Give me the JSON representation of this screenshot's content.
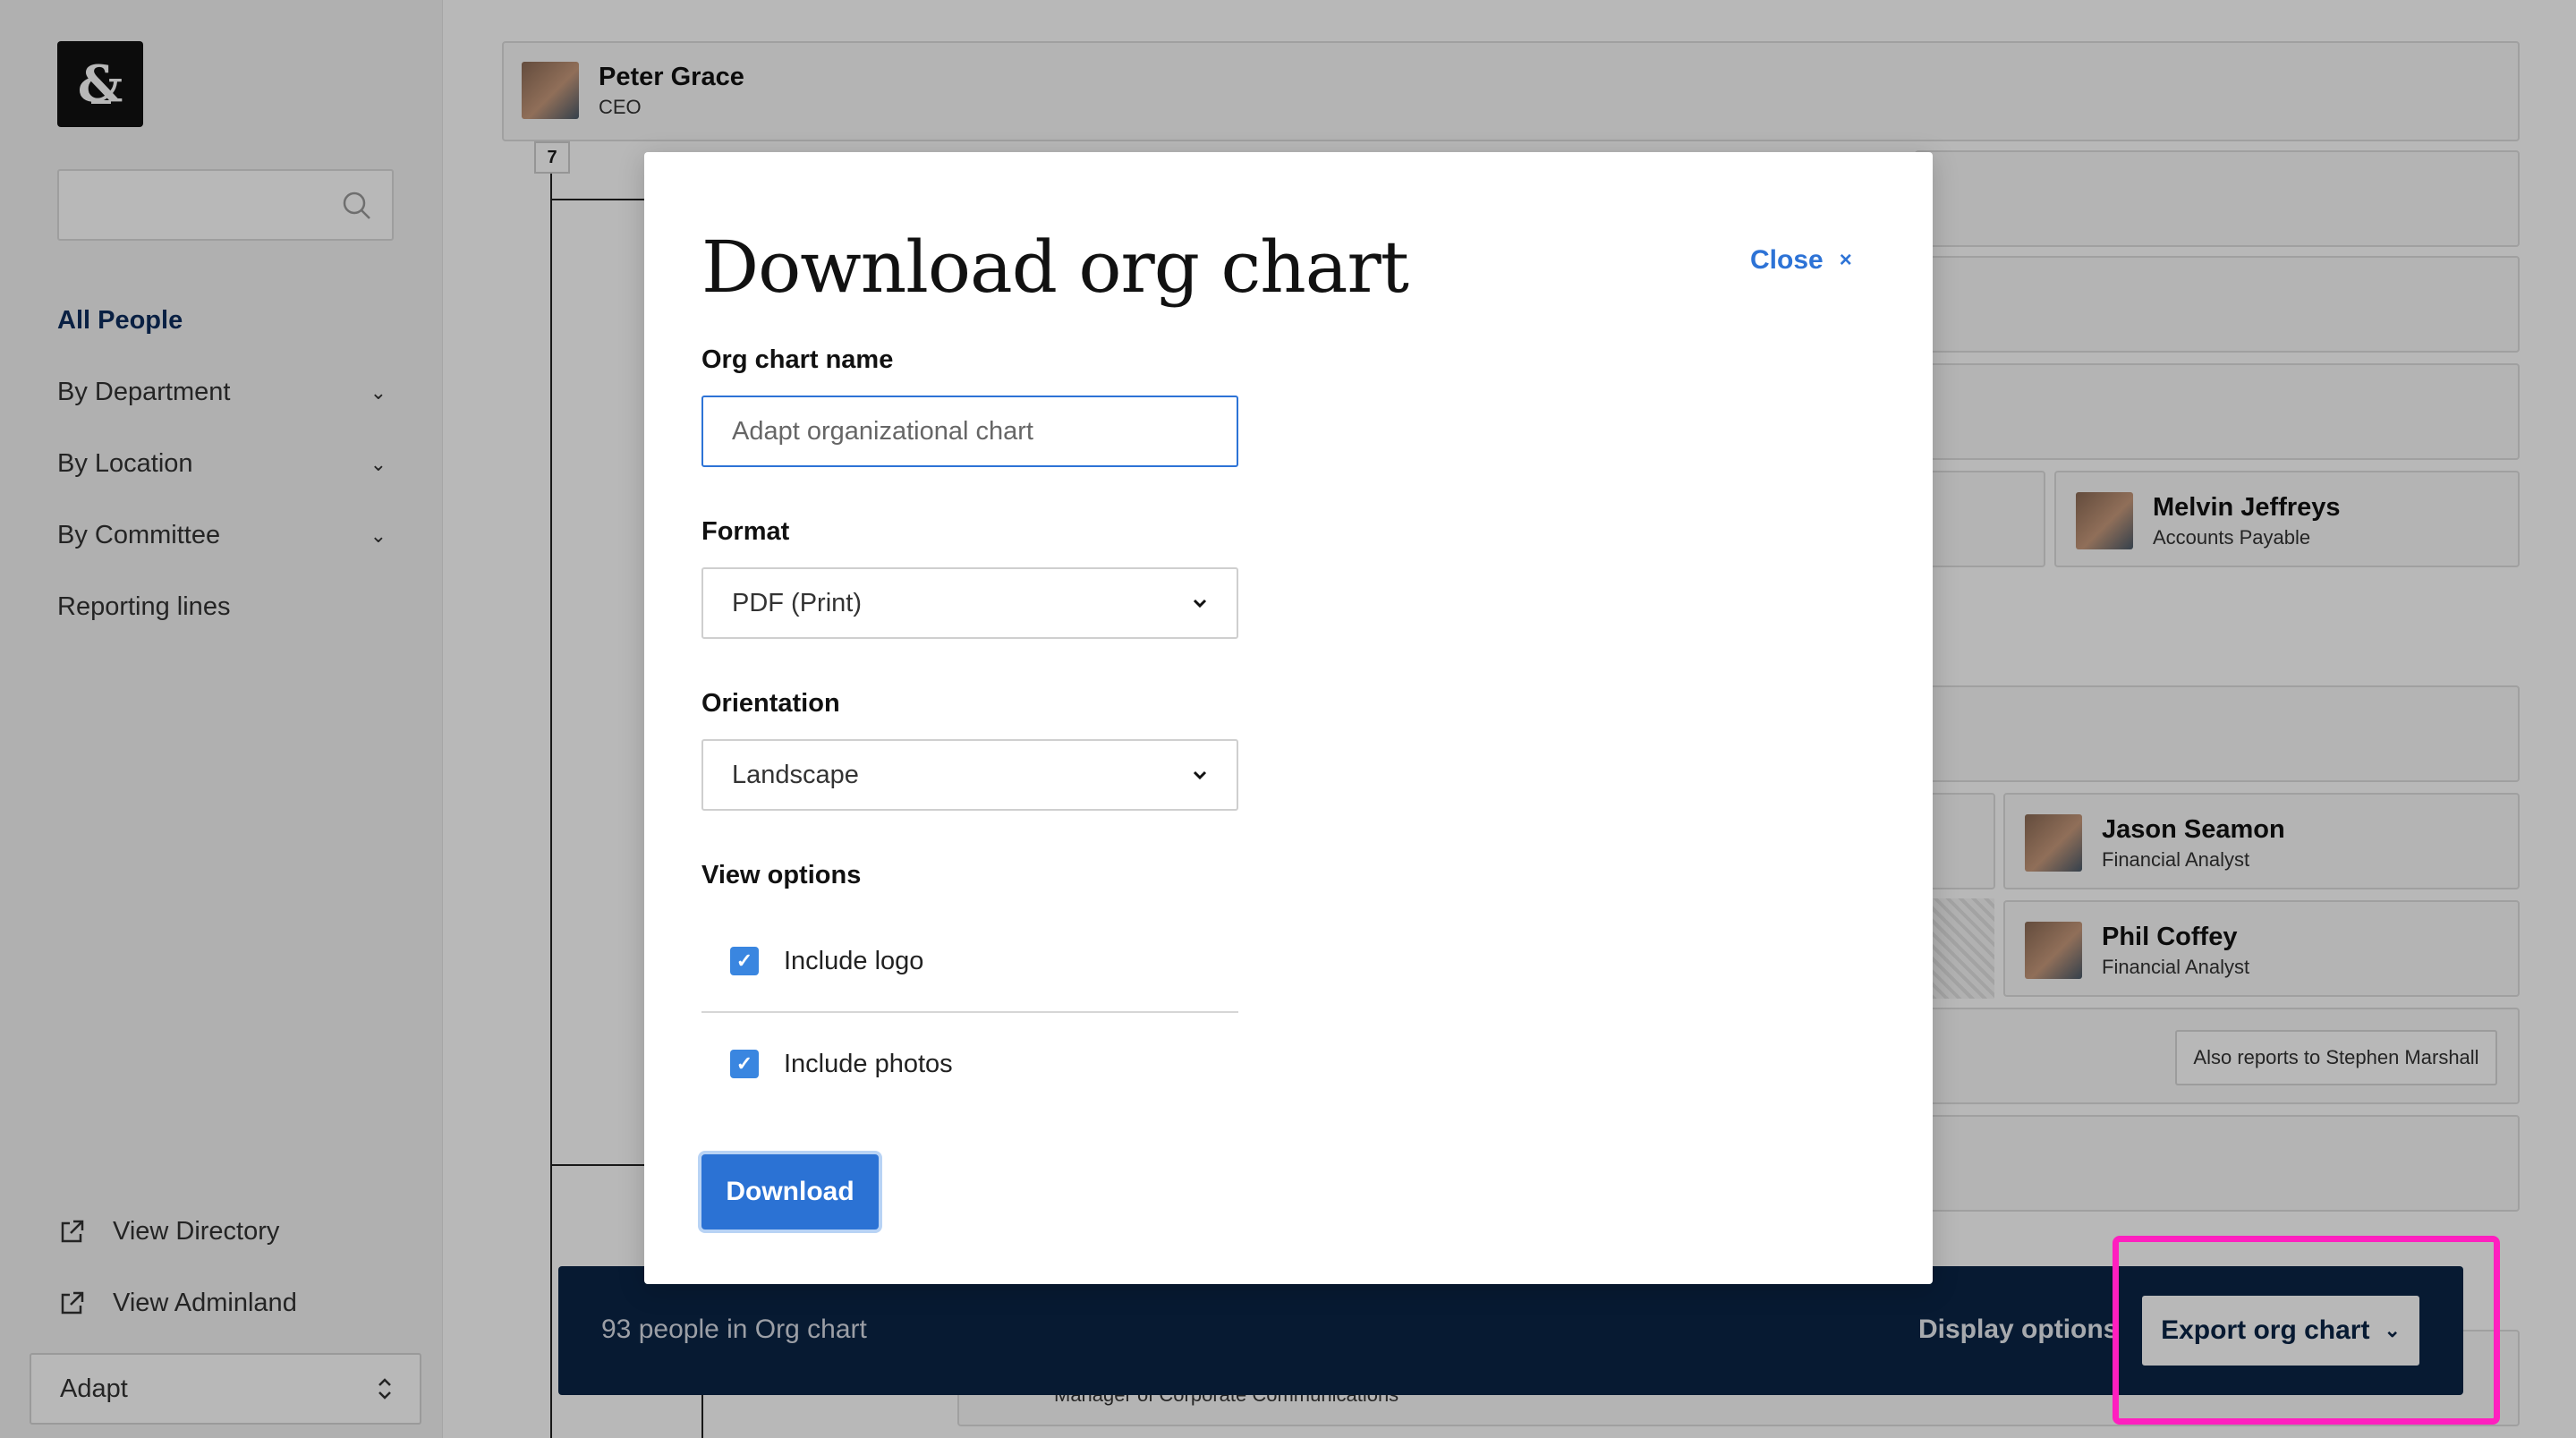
{
  "sidebar": {
    "logo": "&",
    "search": {
      "placeholder": ""
    },
    "nav": [
      {
        "label": "All People",
        "expandable": false,
        "active": true
      },
      {
        "label": "By Department",
        "expandable": true
      },
      {
        "label": "By Location",
        "expandable": true
      },
      {
        "label": "By Committee",
        "expandable": true
      },
      {
        "label": "Reporting lines",
        "expandable": false
      }
    ],
    "links": [
      {
        "label": "View Directory",
        "icon": "external-link-icon"
      },
      {
        "label": "View Adminland",
        "icon": "external-link-icon"
      }
    ],
    "company_select": "Adapt"
  },
  "chart": {
    "root": {
      "name": "Peter Grace",
      "role": "CEO"
    },
    "child_count": "7",
    "people": [
      {
        "name": "Melvin Jeffreys",
        "role": "Accounts Payable"
      },
      {
        "name": "Jason Seamon",
        "role": "Financial Analyst"
      },
      {
        "name": "Phil Coffey",
        "role": "Financial Analyst"
      }
    ],
    "also_reports": "Also reports to Stephen Marshall",
    "partial_role": "Manager of Corporate Communications"
  },
  "bottom_bar": {
    "count_text": "93 people in Org chart",
    "display_options": "Display options",
    "export_label": "Export org chart"
  },
  "modal": {
    "title": "Download org chart",
    "close_label": "Close",
    "name_label": "Org chart name",
    "name_placeholder": "Adapt organizational chart",
    "format_label": "Format",
    "format_value": "PDF (Print)",
    "orientation_label": "Orientation",
    "orientation_value": "Landscape",
    "view_options_label": "View options",
    "options": [
      {
        "label": "Include logo",
        "checked": true
      },
      {
        "label": "Include photos",
        "checked": true
      }
    ],
    "download_label": "Download"
  },
  "colors": {
    "accent": "#2b72d4",
    "navy": "#0b2546",
    "highlight": "#ff1fbf"
  }
}
